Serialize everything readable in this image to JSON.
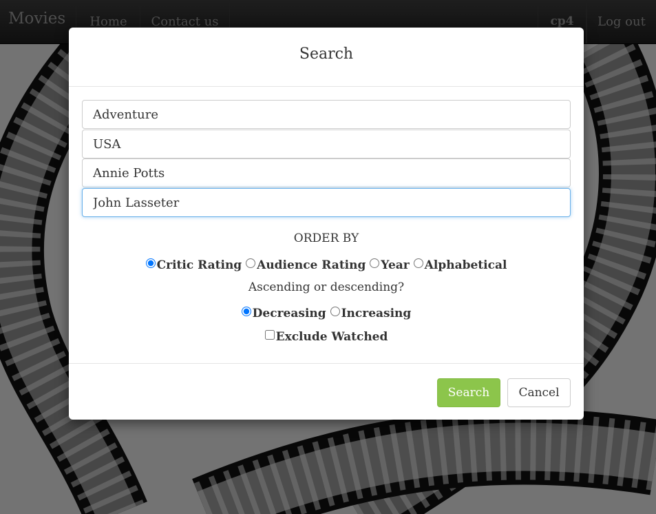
{
  "navbar": {
    "brand": "Movies",
    "home": "Home",
    "contact": "Contact us",
    "user": "cp4",
    "logout": "Log out"
  },
  "modal": {
    "title": "Search",
    "fields": {
      "genre": "Adventure",
      "country": "USA",
      "actor": "Annie Potts",
      "director": "John Lasseter"
    },
    "order_by_label": "ORDER BY",
    "order_options": {
      "critic": "Critic Rating",
      "audience": "Audience Rating",
      "year": "Year",
      "alpha": "Alphabetical"
    },
    "order_selected": "Critic Rating",
    "asc_desc_label": "Ascending or descending?",
    "direction_options": {
      "decreasing": "Decreasing",
      "increasing": "Increasing"
    },
    "direction_selected": "Decreasing",
    "exclude_label": "Exclude Watched",
    "exclude_checked": false,
    "search_button": "Search",
    "cancel_button": "Cancel"
  },
  "colors": {
    "search_button": "#8cc54b",
    "focus_border": "#66afe9"
  }
}
